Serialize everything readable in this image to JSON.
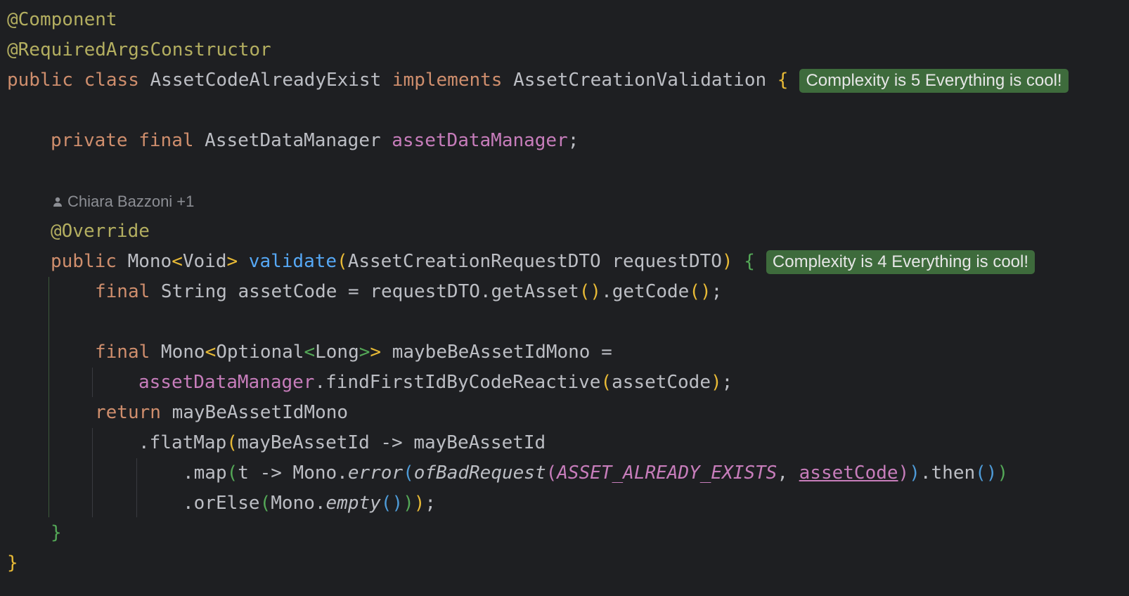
{
  "editor": {
    "annotation_component": "@Component",
    "annotation_required_args": "@RequiredArgsConstructor",
    "class_decl": {
      "kw_public": "public",
      "kw_class": "class",
      "class_name": "AssetCodeAlreadyExist",
      "kw_implements": "implements",
      "interface_name": "AssetCreationValidation",
      "open_brace": "{",
      "complexity_hint": "Complexity is 5 Everything is cool!"
    },
    "field_decl": {
      "kw_private": "private",
      "kw_final": "final",
      "type": "AssetDataManager",
      "name": "assetDataManager",
      "semicolon": ";"
    },
    "author_hint": "Chiara Bazzoni +1",
    "annotation_override": "@Override",
    "method_decl": {
      "kw_public": "public",
      "return_type": "Mono",
      "lt": "<",
      "type_arg": "Void",
      "gt": ">",
      "name": "validate",
      "open_paren": "(",
      "param_type": "AssetCreationRequestDTO",
      "param_name": "requestDTO",
      "close_paren": ")",
      "open_brace": "{",
      "complexity_hint": "Complexity is 4 Everything is cool!"
    },
    "code": {
      "kw_final": "final",
      "kw_return": "return",
      "asset_code_decl": " String assetCode = requestDTO.getAsset",
      "get_code": ".getCode",
      "paren_open": "(",
      "paren_close": ")",
      "semicolon": ";",
      "mono": " Mono",
      "optional": "Optional",
      "long": "Long",
      "lt": "<",
      "gt": ">",
      "maybe_decl": " maybeBeAssetIdMono =",
      "asset_data_manager": "assetDataManager",
      "find_first": ".findFirstIdByCodeReactive",
      "asset_code_arg": "assetCode",
      "return_expr": " mayBeAssetIdMono",
      "flat_map": ".flatMap",
      "lambda_head": "mayBeAssetId -> mayBeAssetId",
      "map": ".map",
      "lambda_t": "t -> Mono.",
      "error": "error",
      "of_bad_request": "ofBadRequest",
      "const_exists": "ASSET_ALREADY_EXISTS",
      "comma": ", ",
      "asset_code_ref": "assetCode",
      "then": ".then",
      "or_else": ".orElse",
      "mono_dot": "Mono.",
      "empty": "empty",
      "close_brace": "}"
    }
  },
  "colors": {
    "background": "#1e1f22",
    "text": "#bcbec4",
    "keyword": "#cf8e6d",
    "annotation": "#b3ae60",
    "field": "#c77dbb",
    "function": "#56a8f5",
    "brace_gold": "#e8ba36",
    "brace_green": "#54a857",
    "brace_blue": "#4e9bd8",
    "hint_badge": "#3e6b3c"
  },
  "icons": {
    "author": "person-icon"
  }
}
